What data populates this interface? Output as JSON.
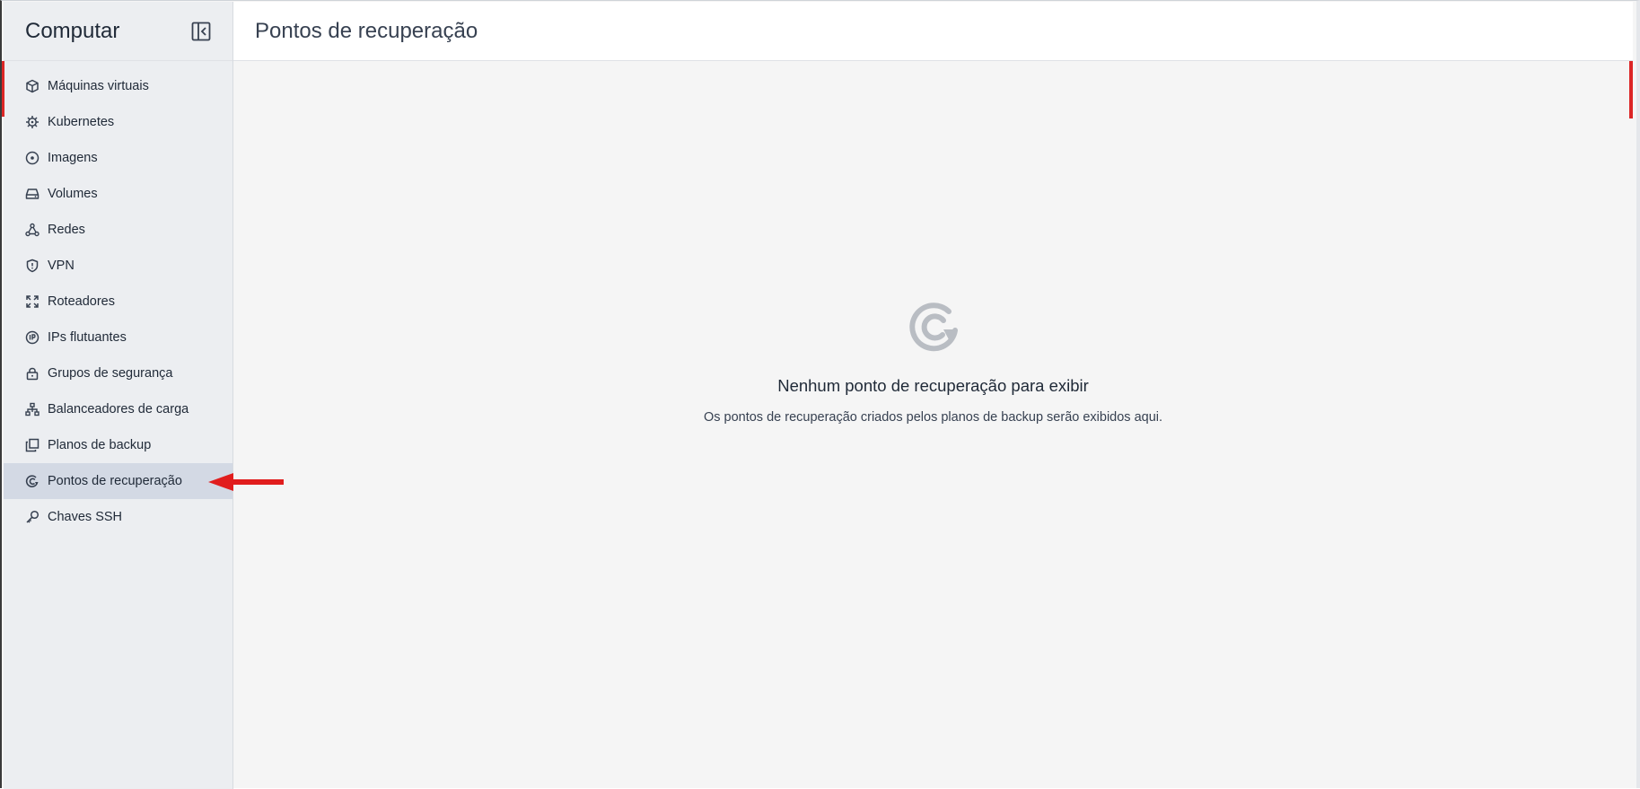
{
  "sidebar": {
    "title": "Computar",
    "items": [
      {
        "label": "Máquinas virtuais",
        "icon": "cube-icon"
      },
      {
        "label": "Kubernetes",
        "icon": "helm-icon"
      },
      {
        "label": "Imagens",
        "icon": "disc-icon"
      },
      {
        "label": "Volumes",
        "icon": "hard-drive-icon"
      },
      {
        "label": "Redes",
        "icon": "network-icon"
      },
      {
        "label": "VPN",
        "icon": "shield-icon"
      },
      {
        "label": "Roteadores",
        "icon": "router-arrows-icon"
      },
      {
        "label": "IPs flutuantes",
        "icon": "ip-badge-icon"
      },
      {
        "label": "Grupos de segurança",
        "icon": "lock-icon"
      },
      {
        "label": "Balanceadores de carga",
        "icon": "sitemap-icon"
      },
      {
        "label": "Planos de backup",
        "icon": "copy-icon"
      },
      {
        "label": "Pontos de recuperação",
        "icon": "restore-icon",
        "active": true
      },
      {
        "label": "Chaves SSH",
        "icon": "key-icon"
      }
    ]
  },
  "main": {
    "title": "Pontos de recuperação",
    "empty_state": {
      "icon": "restore-icon",
      "title": "Nenhum ponto de recuperação para exibir",
      "description": "Os pontos de recuperação criados pelos planos de backup serão exibidos aqui."
    }
  },
  "colors": {
    "accent": "#dc2626",
    "sidebar_bg": "#eceef1",
    "active_bg": "#d3d9e4",
    "content_bg": "#f5f5f5"
  }
}
